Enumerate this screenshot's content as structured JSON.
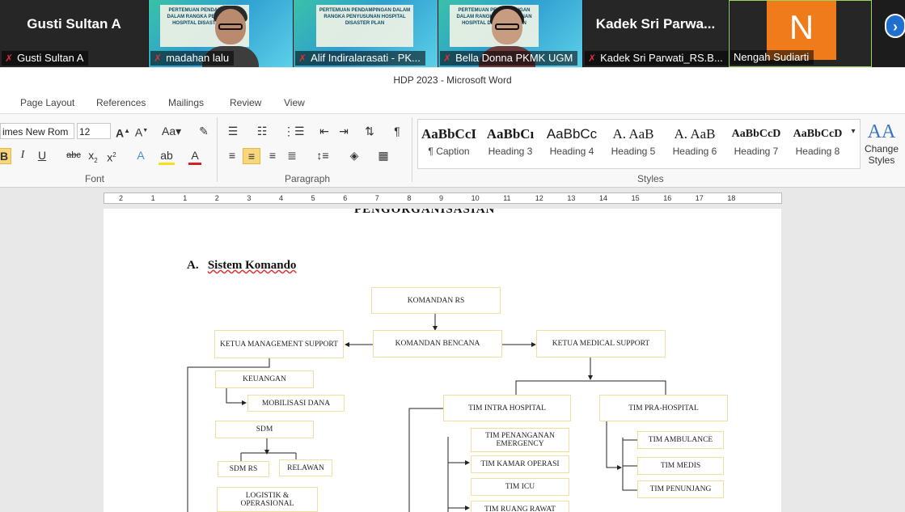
{
  "participants": [
    {
      "big_name": "Gusti Sultan A",
      "label": "Gusti Sultan A"
    },
    {
      "label": "madahan lalu"
    },
    {
      "label": "Alif Indiralarasati - PK..."
    },
    {
      "label": "Bella Donna PKMK UGM"
    },
    {
      "big_name": "Kadek Sri Parwa...",
      "label": "Kadek Sri Parwati_RS.B..."
    },
    {
      "avatar_letter": "N",
      "label": "Nengah Sudiarti"
    }
  ],
  "slide_text": "PERTEMUAN PENDAMPINGAN DALAM RANGKA PENYUSUNAN HOSPITAL DISASTER PLAN",
  "window_title": "HDP 2023  -  Microsoft Word",
  "tabs": [
    "Page Layout",
    "References",
    "Mailings",
    "Review",
    "View"
  ],
  "font": {
    "name": "imes New Rom",
    "size": "12",
    "group_label": "Font"
  },
  "paragraph_group_label": "Paragraph",
  "styles": {
    "group_label": "Styles",
    "items": [
      {
        "preview": "AaBbCcI",
        "name": "¶ Caption"
      },
      {
        "preview": "AaBbCı",
        "name": "Heading 3"
      },
      {
        "preview": "AaBbCc",
        "name": "Heading 4"
      },
      {
        "preview": "A.  AaB",
        "name": "Heading 5"
      },
      {
        "preview": "A.  AaB",
        "name": "Heading 6"
      },
      {
        "preview": "AaBbCcD",
        "name": "Heading 7"
      },
      {
        "preview": "AaBbCcD",
        "name": "Heading 8"
      }
    ],
    "change_label_1": "Change",
    "change_label_2": "Styles"
  },
  "ruler_numbers": [
    "2",
    "1",
    "1",
    "2",
    "3",
    "4",
    "5",
    "6",
    "7",
    "8",
    "9",
    "10",
    "11",
    "12",
    "13",
    "14",
    "15",
    "16",
    "17",
    "18"
  ],
  "document": {
    "top_heading": "PENGORGANISASIAN",
    "section_letter": "A.",
    "section_title": "Sistem Komando",
    "org_chart": {
      "komandan_rs": "KOMANDAN RS",
      "komandan_bencana": "KOMANDAN BENCANA",
      "ketua_management": "KETUA MANAGEMENT SUPPORT",
      "ketua_medical": "KETUA MEDICAL SUPPORT",
      "keuangan": "KEUANGAN",
      "mobilisasi_dana": "MOBILISASI DANA",
      "sdm": "SDM",
      "sdm_rs": "SDM RS",
      "relawan": "RELAWAN",
      "logistik": "LOGISTIK & OPERASIONAL",
      "tim_intra": "TIM INTRA HOSPITAL",
      "tim_pra": "TIM PRA-HOSPITAL",
      "tim_penanganan": "TIM PENANGANAN EMERGENCY",
      "tim_kamar": "TIM KAMAR OPERASI",
      "tim_icu": "TIM ICU",
      "tim_ruang": "TIM RUANG RAWAT",
      "tim_ambulance": "TIM AMBULANCE",
      "tim_medis": "TIM MEDIS",
      "tim_penunjang": "TIM PENUNJANG"
    }
  }
}
